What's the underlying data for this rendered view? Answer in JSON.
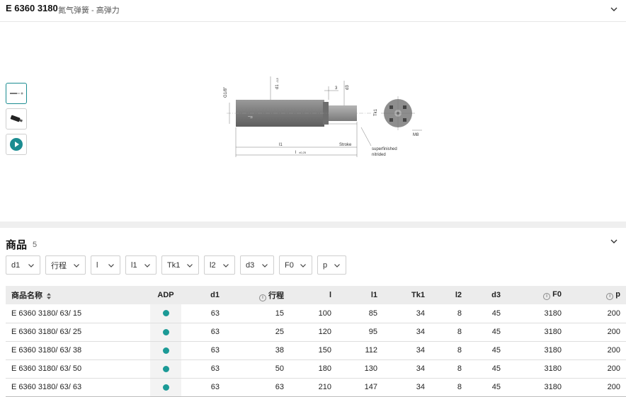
{
  "header": {
    "code": "E 6360 3180",
    "description": "氮气弹簧 - 高弹力"
  },
  "drawing": {
    "labels": {
      "g": "G1/8\"",
      "d1": "d1",
      "d1_tol": "-0,5",
      "three": "3",
      "d3": "d3",
      "tk1": "Tk1",
      "m8": "M8",
      "l1": "l1",
      "stroke": "Stroke",
      "l": "l",
      "l_tol": "±0,25",
      "superfinished": "superfinished",
      "nitrided": "nitrided",
      "logo": "⫎"
    }
  },
  "products": {
    "title": "商品",
    "count": "5",
    "filters": [
      "d1",
      "行程",
      "l",
      "l1",
      "Tk1",
      "l2",
      "d3",
      "F0",
      "p"
    ],
    "columns": {
      "name": "商品名称",
      "adp": "ADP",
      "d1": "d1",
      "stroke": "行程",
      "l": "l",
      "l1": "l1",
      "tk1": "Tk1",
      "l2": "l2",
      "d3": "d3",
      "f0": "F0",
      "p": "p"
    },
    "rows": [
      {
        "name": "E 6360 3180/ 63/ 15",
        "d1": "63",
        "stroke": "15",
        "l": "100",
        "l1": "85",
        "tk1": "34",
        "l2": "8",
        "d3": "45",
        "f0": "3180",
        "p": "200"
      },
      {
        "name": "E 6360 3180/ 63/ 25",
        "d1": "63",
        "stroke": "25",
        "l": "120",
        "l1": "95",
        "tk1": "34",
        "l2": "8",
        "d3": "45",
        "f0": "3180",
        "p": "200"
      },
      {
        "name": "E 6360 3180/ 63/ 38",
        "d1": "63",
        "stroke": "38",
        "l": "150",
        "l1": "112",
        "tk1": "34",
        "l2": "8",
        "d3": "45",
        "f0": "3180",
        "p": "200"
      },
      {
        "name": "E 6360 3180/ 63/ 50",
        "d1": "63",
        "stroke": "50",
        "l": "180",
        "l1": "130",
        "tk1": "34",
        "l2": "8",
        "d3": "45",
        "f0": "3180",
        "p": "200"
      },
      {
        "name": "E 6360 3180/ 63/ 63",
        "d1": "63",
        "stroke": "63",
        "l": "210",
        "l1": "147",
        "tk1": "34",
        "l2": "8",
        "d3": "45",
        "f0": "3180",
        "p": "200"
      }
    ]
  },
  "colors": {
    "accent": "#1b9a96",
    "header_bg": "#ececec",
    "divider": "#efefef"
  }
}
